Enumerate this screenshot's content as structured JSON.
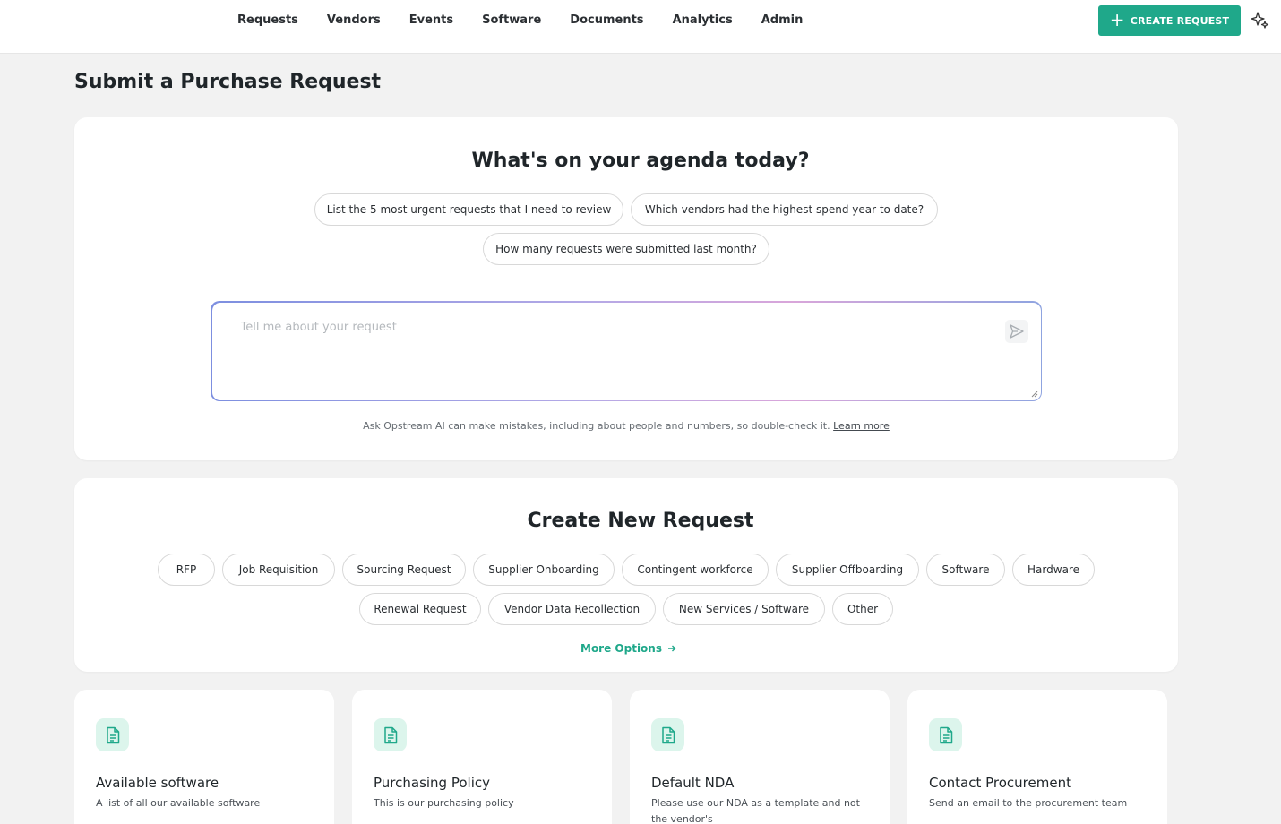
{
  "nav": {
    "items": [
      "Requests",
      "Vendors",
      "Events",
      "Software",
      "Documents",
      "Analytics",
      "Admin"
    ],
    "create_label": "CREATE REQUEST"
  },
  "page": {
    "title": "Submit a Purchase Request"
  },
  "agenda": {
    "title": "What's on your agenda today?",
    "suggestions": [
      "List the 5 most urgent requests that I need to review",
      "Which vendors had the highest spend year to date?",
      "How many requests were submitted last month?"
    ],
    "placeholder": "Tell me about your request",
    "disclaimer": "Ask Opstream AI can make mistakes, including about people and numbers, so double-check it.",
    "learn_more": "Learn more"
  },
  "create": {
    "title": "Create New Request",
    "options": [
      "RFP",
      "Job Requisition",
      "Sourcing Request",
      "Supplier Onboarding",
      "Contingent workforce",
      "Supplier Offboarding",
      "Software",
      "Hardware",
      "Renewal Request",
      "Vendor Data Recollection",
      "New Services / Software",
      "Other"
    ],
    "more_options": "More Options"
  },
  "resources": [
    {
      "title": "Available software",
      "description": "A list of all our available software"
    },
    {
      "title": "Purchasing Policy",
      "description": "This is our purchasing policy"
    },
    {
      "title": "Default NDA",
      "description": "Please use our NDA as a template and not the vendor's"
    },
    {
      "title": "Contact Procurement",
      "description": "Send an email to the procurement team"
    }
  ],
  "colors": {
    "accent": "#1fa88a",
    "icon_bg": "#dcf5ec",
    "page_bg": "#f2f2f2"
  }
}
